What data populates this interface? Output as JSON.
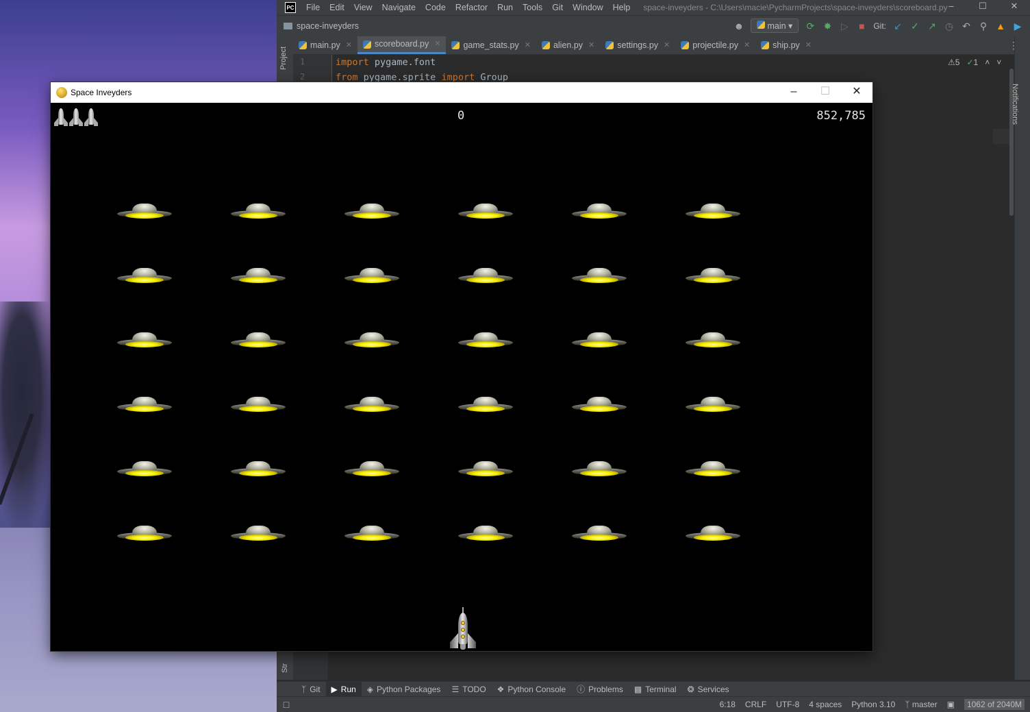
{
  "ide": {
    "logo_text": "PC",
    "menu": [
      "File",
      "Edit",
      "View",
      "Navigate",
      "Code",
      "Refactor",
      "Run",
      "Tools",
      "Git",
      "Window",
      "Help"
    ],
    "window_title": "space-inveyders - C:\\Users\\macie\\PycharmProjects\\space-inveyders\\scoreboard.py",
    "project_name": "space-inveyders",
    "branch_button": "main",
    "git_label": "Git:",
    "tabs": [
      {
        "label": "main.py",
        "active": false
      },
      {
        "label": "scoreboard.py",
        "active": true
      },
      {
        "label": "game_stats.py",
        "active": false
      },
      {
        "label": "alien.py",
        "active": false
      },
      {
        "label": "settings.py",
        "active": false
      },
      {
        "label": "projectile.py",
        "active": false
      },
      {
        "label": "ship.py",
        "active": false
      }
    ],
    "side_left_label": "Project",
    "side_left_bottom_label": "Str",
    "side_right_label": "Notifications",
    "inspections": {
      "warnings": "5",
      "ok": "1"
    },
    "code_lines": [
      {
        "num": "1",
        "kw1": "import",
        "rest1": " pygame.font",
        "kw2": "",
        "rest2": ""
      },
      {
        "num": "2",
        "kw1": "from",
        "rest1": " pygame.sprite ",
        "kw2": "import",
        "rest2": " Group"
      }
    ],
    "tool_windows": [
      {
        "label": "Git",
        "icon": "git-branch-icon",
        "active": false
      },
      {
        "label": "Run",
        "icon": "play-icon",
        "active": true
      },
      {
        "label": "Python Packages",
        "icon": "packages-icon",
        "active": false
      },
      {
        "label": "TODO",
        "icon": "list-icon",
        "active": false
      },
      {
        "label": "Python Console",
        "icon": "console-icon",
        "active": false
      },
      {
        "label": "Problems",
        "icon": "info-icon",
        "active": false
      },
      {
        "label": "Terminal",
        "icon": "terminal-icon",
        "active": false
      },
      {
        "label": "Services",
        "icon": "services-icon",
        "active": false
      }
    ],
    "status": {
      "position": "6:18",
      "line_sep": "CRLF",
      "encoding": "UTF-8",
      "indent": "4 spaces",
      "interpreter": "Python 3.10",
      "branch": "master",
      "memory": "1062 of 2040M"
    }
  },
  "game": {
    "title": "Space Inveyders",
    "score": "0",
    "high_score": "852,785",
    "lives": 3,
    "alien_rows": 6,
    "alien_cols": 6
  }
}
